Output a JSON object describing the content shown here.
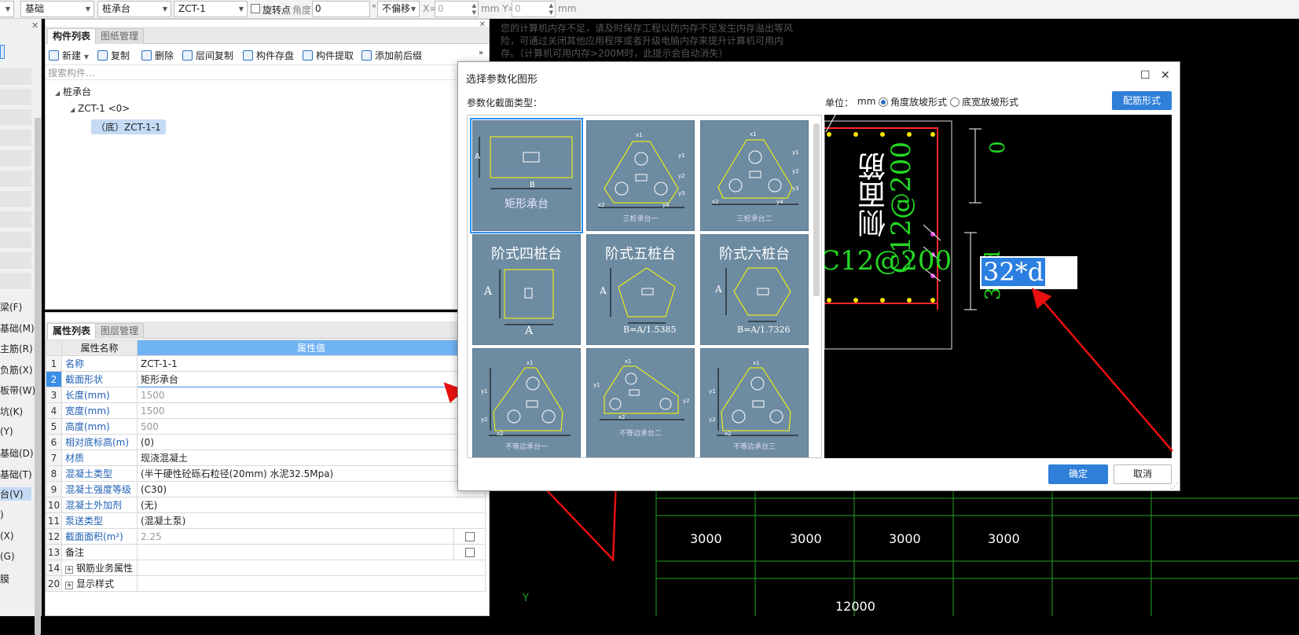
{
  "topbar": {
    "type_select": "基础",
    "component_select": "桩承台",
    "item_select": "ZCT-1",
    "rotate_label": "旋转点",
    "angle_label": "角度:",
    "angle_value": "0",
    "degree_symbol": "°",
    "offset_select": "不偏移",
    "x_label": "X=",
    "x_value": "0",
    "unit_mm_y": "mm Y=",
    "y_value": "0",
    "unit_mm": "mm"
  },
  "left_strip": {
    "labels": [
      "梁(F)",
      "基础(M)",
      "主筋(R)",
      "负筋(X)",
      "板带(W)",
      "坑(K)",
      "(Y)",
      "基础(D)",
      "基础(T)",
      "台(V)",
      ")",
      "(X)",
      "(G)",
      "膜"
    ]
  },
  "component_panel": {
    "tabs": [
      "构件列表",
      "图纸管理"
    ],
    "toolbar": [
      "新建",
      "复制",
      "删除",
      "层间复制",
      "构件存盘",
      "构件提取",
      "添加前后缀"
    ],
    "search_placeholder": "搜索构件...",
    "tree": {
      "root": "桩承台",
      "child": "ZCT-1 <0>",
      "leaf": "（底）ZCT-1-1"
    }
  },
  "property_panel": {
    "tabs": [
      "属性列表",
      "图层管理"
    ],
    "headers": [
      "属性名称",
      "属性值"
    ],
    "rows": [
      {
        "num": "1",
        "name": "名称",
        "value": "ZCT-1-1"
      },
      {
        "num": "2",
        "name": "截面形状",
        "value": "矩形承台"
      },
      {
        "num": "3",
        "name": "长度(mm)",
        "value": "1500"
      },
      {
        "num": "4",
        "name": "宽度(mm)",
        "value": "1500"
      },
      {
        "num": "5",
        "name": "高度(mm)",
        "value": "500"
      },
      {
        "num": "6",
        "name": "相对底标高(m)",
        "value": "(0)"
      },
      {
        "num": "7",
        "name": "材质",
        "value": "现浇混凝土"
      },
      {
        "num": "8",
        "name": "混凝土类型",
        "value": "(半干硬性砼砾石粒径(20mm) 水泥32.5Mpa)"
      },
      {
        "num": "9",
        "name": "混凝土强度等级",
        "value": "(C30)"
      },
      {
        "num": "10",
        "name": "混凝土外加剂",
        "value": "(无)"
      },
      {
        "num": "11",
        "name": "泵送类型",
        "value": "(混凝土泵)"
      },
      {
        "num": "12",
        "name": "截面面积(m²)",
        "value": "2.25"
      },
      {
        "num": "13",
        "name": "备注",
        "value": ""
      },
      {
        "num": "14",
        "name": "钢筋业务属性",
        "value": ""
      },
      {
        "num": "20",
        "name": "显示样式",
        "value": ""
      }
    ],
    "ellipsis": "···"
  },
  "cad": {
    "warning": "您的计算机内存不足，请及时保存工程以防内存不足发生内存溢出等风险，可通过关闭其他应用程序或者升级电脑内存来提升计算机可用内存。（计算机可用内存>200M时，此提示会自动消失）",
    "dims": [
      "3000",
      "3000",
      "3000",
      "3000"
    ],
    "axis_label": "Y",
    "total_dim": "12000"
  },
  "dialog": {
    "title": "选择参数化图形",
    "section_label": "参数化截面类型：",
    "unit_label": "单位：",
    "unit_value": "mm",
    "radio_angle": "角度放坡形式",
    "radio_width": "底宽放坡形式",
    "config_button": "配筋形式",
    "ok_button": "确定",
    "cancel_button": "取消",
    "thumbnails": [
      {
        "label": "矩形承台",
        "dims": [
          "A",
          "B"
        ]
      },
      {
        "label": "三桩承台一",
        "dims": [
          "x1",
          "x2",
          "y1",
          "y2",
          "y3",
          "y4"
        ]
      },
      {
        "label": "三桩承台二",
        "dims": [
          "x1",
          "x2",
          "y1",
          "y2",
          "y3",
          "y4"
        ]
      },
      {
        "label": "阶式四桩台",
        "dims": [
          "A",
          "A"
        ]
      },
      {
        "label": "阶式五桩台",
        "dims": [
          "A",
          "B=A/1.5385"
        ]
      },
      {
        "label": "阶式六桩台",
        "dims": [
          "A",
          "B=A/1.7326"
        ]
      },
      {
        "label": "不等边承台一",
        "dims": [
          "x1",
          "x2",
          "y1",
          "y2"
        ]
      },
      {
        "label": "不等边承台二",
        "dims": [
          "x1",
          "x2",
          "y1",
          "y2"
        ]
      },
      {
        "label": "不等边承台三",
        "dims": [
          "x1",
          "x2",
          "y1",
          "y2"
        ]
      }
    ],
    "preview": {
      "side_bar_text": "侧面筋",
      "side_bar_spec": "C12@200",
      "bottom_spec": "C12@200",
      "edit_value": "32*d",
      "dim_top": "0",
      "dim_side": "32*d"
    }
  }
}
